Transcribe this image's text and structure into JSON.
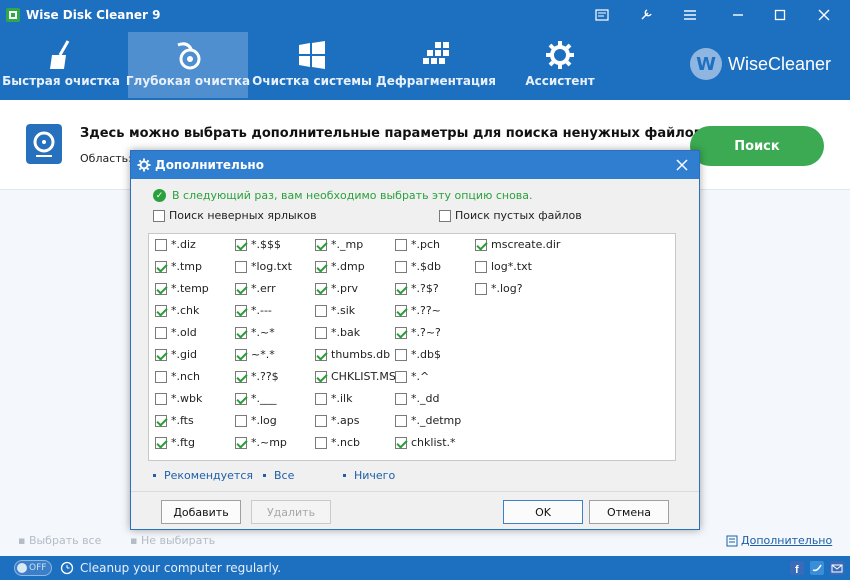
{
  "app": {
    "title": "Wise Disk Cleaner 9",
    "brand": "WiseCleaner",
    "brand_letter": "W"
  },
  "nav": {
    "items": [
      {
        "label": "Быстрая очистка",
        "icon": "broom-icon"
      },
      {
        "label": "Глубокая очистка",
        "icon": "vacuum-icon",
        "active": true
      },
      {
        "label": "Очистка системы",
        "icon": "windows-icon"
      },
      {
        "label": "Дефрагментация",
        "icon": "defrag-icon"
      },
      {
        "label": "Ассистент",
        "icon": "assistant-gear-icon"
      }
    ]
  },
  "main": {
    "info_title": "Здесь можно выбрать дополнительные параметры для поиска ненужных файлов.",
    "area_label": "Область:",
    "scan_button": "Поиск",
    "select_all": "Выбрать все",
    "select_none": "Не выбирать",
    "advanced_link": "Дополнительно"
  },
  "status": {
    "toggle": "OFF",
    "text": "Cleanup your computer regularly."
  },
  "dialog": {
    "title": "Дополнительно",
    "notice": "В следующий раз, вам необходимо выбрать эту опцию снова.",
    "option_invalid_shortcuts": {
      "label": "Поиск неверных ярлыков",
      "checked": false
    },
    "option_empty_files": {
      "label": "Поиск пустых файлов",
      "checked": false
    },
    "columns": [
      [
        {
          "label": "*.diz",
          "checked": false
        },
        {
          "label": "*.tmp",
          "checked": true
        },
        {
          "label": "*.temp",
          "checked": true
        },
        {
          "label": "*.chk",
          "checked": true
        },
        {
          "label": "*.old",
          "checked": false
        },
        {
          "label": "*.gid",
          "checked": true
        },
        {
          "label": "*.nch",
          "checked": false
        },
        {
          "label": "*.wbk",
          "checked": false
        },
        {
          "label": "*.fts",
          "checked": true
        },
        {
          "label": "*.ftg",
          "checked": true
        }
      ],
      [
        {
          "label": "*.$$$",
          "checked": true
        },
        {
          "label": "*log.txt",
          "checked": false
        },
        {
          "label": "*.err",
          "checked": true
        },
        {
          "label": "*.---",
          "checked": true
        },
        {
          "label": "*.~*",
          "checked": true
        },
        {
          "label": "~*.*",
          "checked": true
        },
        {
          "label": "*.??$",
          "checked": true
        },
        {
          "label": "*.___",
          "checked": true
        },
        {
          "label": "*.log",
          "checked": false
        },
        {
          "label": "*.~mp",
          "checked": true
        }
      ],
      [
        {
          "label": "*._mp",
          "checked": true
        },
        {
          "label": "*.dmp",
          "checked": true
        },
        {
          "label": "*.prv",
          "checked": true
        },
        {
          "label": "*.sik",
          "checked": false
        },
        {
          "label": "*.bak",
          "checked": false
        },
        {
          "label": "thumbs.db",
          "checked": true
        },
        {
          "label": "CHKLIST.MS",
          "checked": true
        },
        {
          "label": "*.ilk",
          "checked": false
        },
        {
          "label": "*.aps",
          "checked": false
        },
        {
          "label": "*.ncb",
          "checked": false
        }
      ],
      [
        {
          "label": "*.pch",
          "checked": false
        },
        {
          "label": "*.$db",
          "checked": false
        },
        {
          "label": "*.?$?",
          "checked": true
        },
        {
          "label": "*.??~",
          "checked": true
        },
        {
          "label": "*.?~?",
          "checked": true
        },
        {
          "label": "*.db$",
          "checked": false
        },
        {
          "label": "*.^",
          "checked": false
        },
        {
          "label": "*._dd",
          "checked": false
        },
        {
          "label": "*._detmp",
          "checked": false
        },
        {
          "label": "chklist.*",
          "checked": true
        }
      ],
      [
        {
          "label": "mscreate.dir",
          "checked": true
        },
        {
          "label": "log*.txt",
          "checked": false
        },
        {
          "label": "*.log?",
          "checked": false
        }
      ]
    ],
    "link_recommended": "Рекомендуется",
    "link_all": "Все",
    "link_none": "Ничего",
    "btn_add": "Добавить",
    "btn_delete": "Удалить",
    "btn_ok": "OK",
    "btn_cancel": "Отмена"
  }
}
